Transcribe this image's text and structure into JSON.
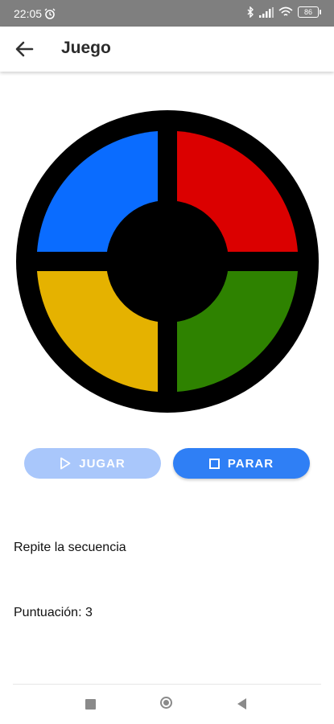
{
  "status_bar": {
    "time": "22:05",
    "battery": "86",
    "icons": [
      "alarm-icon",
      "bluetooth-icon",
      "signal-icon",
      "wifi-icon",
      "battery-icon"
    ]
  },
  "app_bar": {
    "title": "Juego",
    "back_icon": "back-arrow-icon"
  },
  "board": {
    "colors": {
      "blue": "#0a6cff",
      "red": "#db0000",
      "yellow": "#e5b200",
      "green": "#2e8200",
      "frame": "#000000"
    }
  },
  "buttons": {
    "play_label": "JUGAR",
    "stop_label": "PARAR",
    "play_color": "#a9c7fb",
    "stop_color": "#2f7ff5"
  },
  "messages": {
    "instruction": "Repite la secuencia",
    "score": "Puntuación: 3"
  },
  "nav_bar": {
    "icons": [
      "recent-apps-icon",
      "home-icon",
      "nav-back-icon"
    ]
  }
}
